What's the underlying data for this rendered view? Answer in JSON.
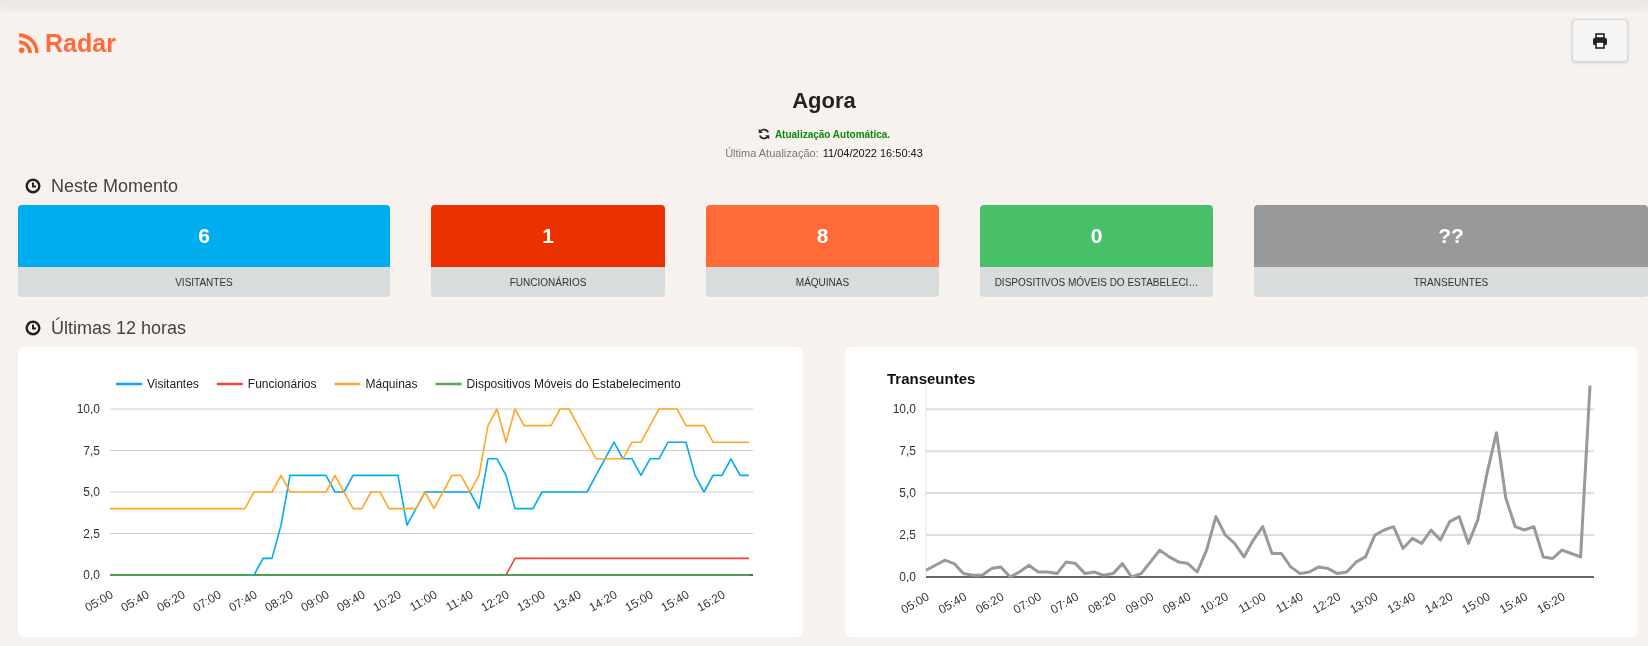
{
  "header": {
    "title": "Radar"
  },
  "status": {
    "heading": "Agora",
    "auto_update": "Atualização Automática.",
    "last_update_label": "Última Atualização:",
    "last_update_value": "11/04/2022 16:50:43"
  },
  "now_section": {
    "title": "Neste Momento",
    "cards": [
      {
        "value": "6",
        "label": "VISITANTES",
        "color": "#00aeef"
      },
      {
        "value": "1",
        "label": "FUNCIONÁRIOS",
        "color": "#ec3100"
      },
      {
        "value": "8",
        "label": "MÁQUINAS",
        "color": "#ff6b38"
      },
      {
        "value": "0",
        "label": "DISPOSITIVOS MÓVEIS DO ESTABELECI…",
        "color": "#48c06a"
      },
      {
        "value": "??",
        "label": "TRANSEUNTES",
        "color": "#999999"
      }
    ]
  },
  "history_section": {
    "title": "Últimas 12 horas",
    "charts": [
      {
        "chart_data": {
          "type": "line",
          "ylim": [
            0,
            10
          ],
          "grid": true,
          "legend": true,
          "categories": [
            "05:00",
            null,
            null,
            null,
            "05:40",
            null,
            null,
            null,
            "06:20",
            null,
            null,
            null,
            "07:00",
            null,
            null,
            null,
            "07:40",
            null,
            null,
            null,
            "08:20",
            null,
            null,
            null,
            "09:00",
            null,
            null,
            null,
            "09:40",
            null,
            null,
            null,
            "10:20",
            null,
            null,
            null,
            "11:00",
            null,
            null,
            null,
            "11:40",
            null,
            null,
            null,
            "12:20",
            null,
            null,
            null,
            "13:00",
            null,
            null,
            null,
            "13:40",
            null,
            null,
            null,
            "14:20",
            null,
            null,
            null,
            "15:00",
            null,
            null,
            null,
            "15:40",
            null,
            null,
            null,
            "16:20",
            null,
            null,
            null
          ],
          "yticks": [
            {
              "value": 0,
              "label": "0,0"
            },
            {
              "value": 2.5,
              "label": "2,5"
            },
            {
              "value": 5,
              "label": "5,0"
            },
            {
              "value": 7.5,
              "label": "7,5"
            },
            {
              "value": 10,
              "label": "10,0"
            }
          ],
          "series": [
            {
              "name": "Visitantes",
              "color": "#03a9f4",
              "values": [
                null,
                null,
                null,
                null,
                null,
                null,
                null,
                null,
                null,
                null,
                null,
                null,
                null,
                null,
                null,
                0,
                0,
                1,
                1,
                3,
                6,
                6,
                6,
                6,
                6,
                5,
                5,
                6,
                6,
                6,
                6,
                6,
                6,
                3,
                4,
                5,
                5,
                5,
                5,
                5,
                5,
                4,
                7,
                7,
                6,
                4,
                4,
                4,
                5,
                5,
                5,
                5,
                5,
                5,
                6,
                7,
                8,
                7,
                7,
                6,
                7,
                7,
                8,
                8,
                8,
                6,
                5,
                6,
                6,
                7,
                6,
                6
              ]
            },
            {
              "name": "Funcionários",
              "color": "#f44336",
              "values": [
                null,
                null,
                null,
                null,
                null,
                null,
                null,
                null,
                null,
                null,
                null,
                null,
                null,
                null,
                null,
                null,
                null,
                null,
                null,
                null,
                null,
                null,
                null,
                null,
                null,
                null,
                null,
                null,
                null,
                null,
                null,
                null,
                null,
                null,
                null,
                null,
                null,
                null,
                null,
                null,
                null,
                null,
                null,
                null,
                0,
                1,
                1,
                1,
                1,
                1,
                1,
                1,
                1,
                1,
                1,
                1,
                1,
                1,
                1,
                1,
                1,
                1,
                1,
                1,
                1,
                1,
                1,
                1,
                1,
                1,
                1,
                1
              ]
            },
            {
              "name": "Máquinas",
              "color": "#ffa726",
              "values": [
                4,
                4,
                4,
                4,
                4,
                4,
                4,
                4,
                4,
                4,
                4,
                4,
                4,
                4,
                4,
                4,
                5,
                5,
                5,
                6,
                5,
                5,
                5,
                5,
                5,
                6,
                5,
                4,
                4,
                5,
                5,
                4,
                4,
                4,
                4,
                5,
                4,
                5,
                6,
                6,
                5,
                6,
                9,
                10,
                8,
                10,
                9,
                9,
                9,
                9,
                10,
                10,
                9,
                8,
                7,
                7,
                7,
                7,
                8,
                8,
                9,
                10,
                10,
                10,
                9,
                9,
                9,
                8,
                8,
                8,
                8,
                8
              ]
            },
            {
              "name": "Dispositivos Móveis do Estabelecimento",
              "color": "#4caf50",
              "values": [
                0,
                0,
                0,
                0,
                0,
                0,
                0,
                0,
                0,
                0,
                0,
                0,
                0,
                0,
                0,
                0,
                0,
                0,
                0,
                0,
                0,
                0,
                0,
                0,
                0,
                0,
                0,
                0,
                0,
                0,
                0,
                0,
                0,
                0,
                0,
                0,
                0,
                0,
                0,
                0,
                0,
                0,
                0,
                0,
                0,
                0,
                0,
                0,
                0,
                0,
                0,
                0,
                0,
                0,
                0,
                0,
                0,
                0,
                0,
                0,
                0,
                0,
                0,
                0,
                0,
                0,
                0,
                0,
                0,
                0,
                0,
                0
              ]
            }
          ]
        }
      },
      {
        "chart_data": {
          "type": "line",
          "title": "Transeuntes",
          "grid": true,
          "ylim": [
            0,
            11.5
          ],
          "categories": [
            "05:00",
            null,
            null,
            null,
            "05:40",
            null,
            null,
            null,
            "06:20",
            null,
            null,
            null,
            "07:00",
            null,
            null,
            null,
            "07:40",
            null,
            null,
            null,
            "08:20",
            null,
            null,
            null,
            "09:00",
            null,
            null,
            null,
            "09:40",
            null,
            null,
            null,
            "10:20",
            null,
            null,
            null,
            "11:00",
            null,
            null,
            null,
            "11:40",
            null,
            null,
            null,
            "12:20",
            null,
            null,
            null,
            "13:00",
            null,
            null,
            null,
            "13:40",
            null,
            null,
            null,
            "14:20",
            null,
            null,
            null,
            "15:00",
            null,
            null,
            null,
            "15:40",
            null,
            null,
            null,
            "16:20",
            null,
            null,
            null
          ],
          "yticks": [
            {
              "value": 0,
              "label": "0,0"
            },
            {
              "value": 2.5,
              "label": "2,5"
            },
            {
              "value": 5,
              "label": "5,0"
            },
            {
              "value": 7.5,
              "label": "7,5"
            },
            {
              "value": 10,
              "label": "10,0"
            }
          ],
          "series": [
            {
              "color": "#999999",
              "values": [
                0.4,
                0.7,
                1.0,
                0.8,
                0.2,
                0.1,
                0.1,
                0.5,
                0.6,
                0,
                0.3,
                0.7,
                0.3,
                0.3,
                0.2,
                0.9,
                0.8,
                0.2,
                0.3,
                0.1,
                0.2,
                0.8,
                0,
                0.2,
                0.9,
                1.6,
                1.2,
                0.9,
                0.8,
                0.3,
                1.6,
                3.6,
                2.5,
                2.0,
                1.2,
                2.2,
                3.0,
                1.4,
                1.4,
                0.6,
                0.2,
                0.3,
                0.6,
                0.5,
                0.2,
                0.3,
                0.9,
                1.2,
                2.5,
                2.8,
                3.0,
                1.7,
                2.3,
                2.0,
                2.8,
                2.2,
                3.3,
                3.6,
                2.0,
                3.4,
                6.2,
                8.6,
                4.7,
                3.0,
                2.8,
                3.0,
                1.2,
                1.1,
                1.6,
                1.4,
                1.2,
                11.4
              ]
            }
          ]
        }
      }
    ]
  }
}
